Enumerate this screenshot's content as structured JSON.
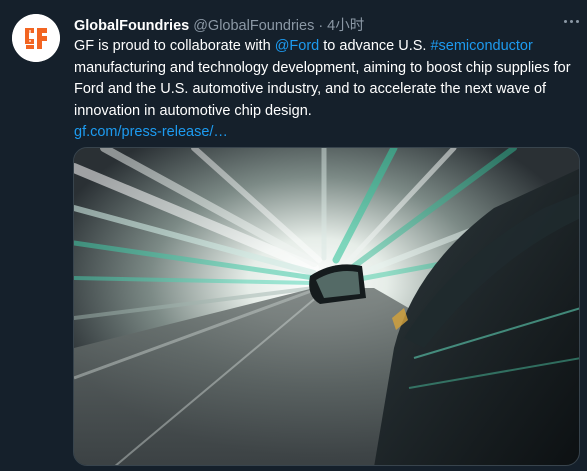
{
  "author": {
    "name": "GlobalFoundries",
    "handle": "@GlobalFoundries",
    "separator": "·",
    "time": "4小时"
  },
  "tweet": {
    "text_intro": "GF is proud to collaborate with ",
    "mention": "@Ford",
    "text_mid": " to advance U.S. ",
    "hashtag": "#semiconductor",
    "text_rest": " manufacturing and technology development, aiming to boost chip supplies for Ford and the U.S. automotive industry, and to accelerate the next wave of innovation in automotive chip design.",
    "link": "gf.com/press-release/…"
  },
  "icons": {
    "avatar": "globalfoundries-logo",
    "more": "more-icon"
  },
  "colors": {
    "background": "#15202b",
    "link": "#1d9bf0",
    "secondary_text": "#8b98a5",
    "brand": "#f26522"
  }
}
